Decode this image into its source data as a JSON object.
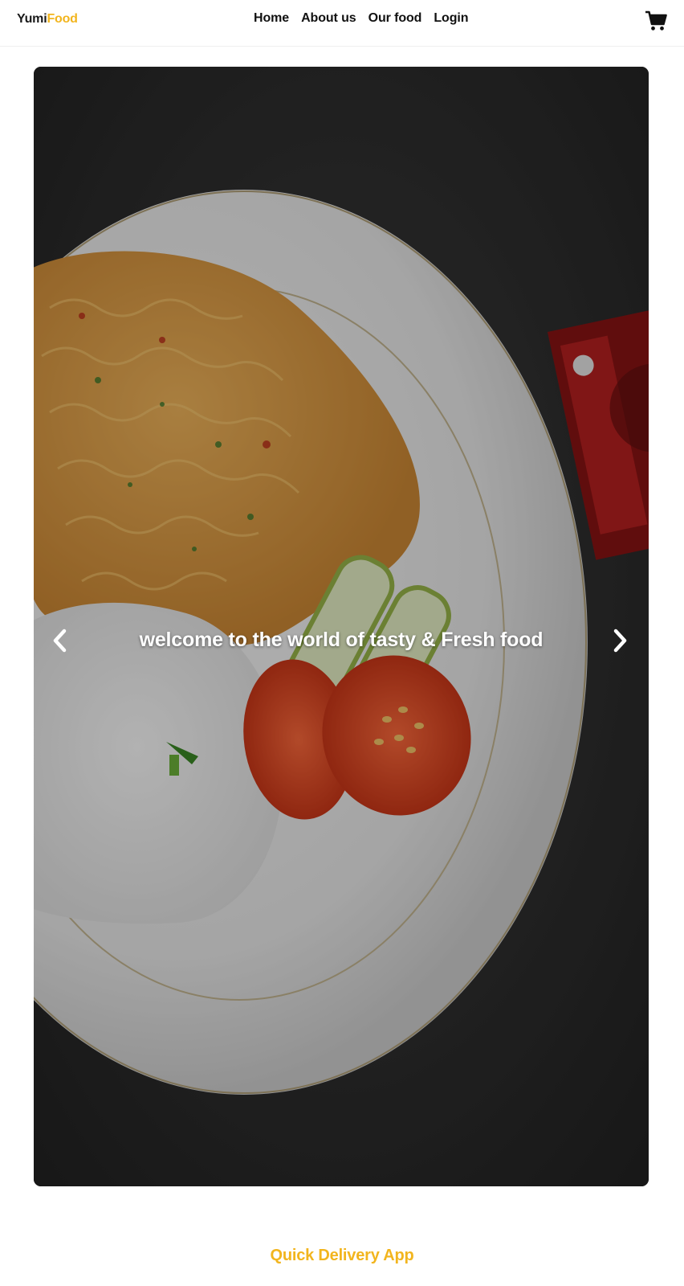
{
  "brand": {
    "part1": "Yumi",
    "part2": "Food",
    "accent_color": "#f2b51e"
  },
  "nav": {
    "links": [
      "Home",
      "About us",
      "Our food",
      "Login"
    ],
    "cart_icon": "shopping-cart-icon"
  },
  "hero": {
    "caption": "welcome to the world of tasty & Fresh food",
    "prev_icon": "chevron-left-icon",
    "next_icon": "chevron-right-icon"
  },
  "section": {
    "title": "Quick Delivery App"
  }
}
